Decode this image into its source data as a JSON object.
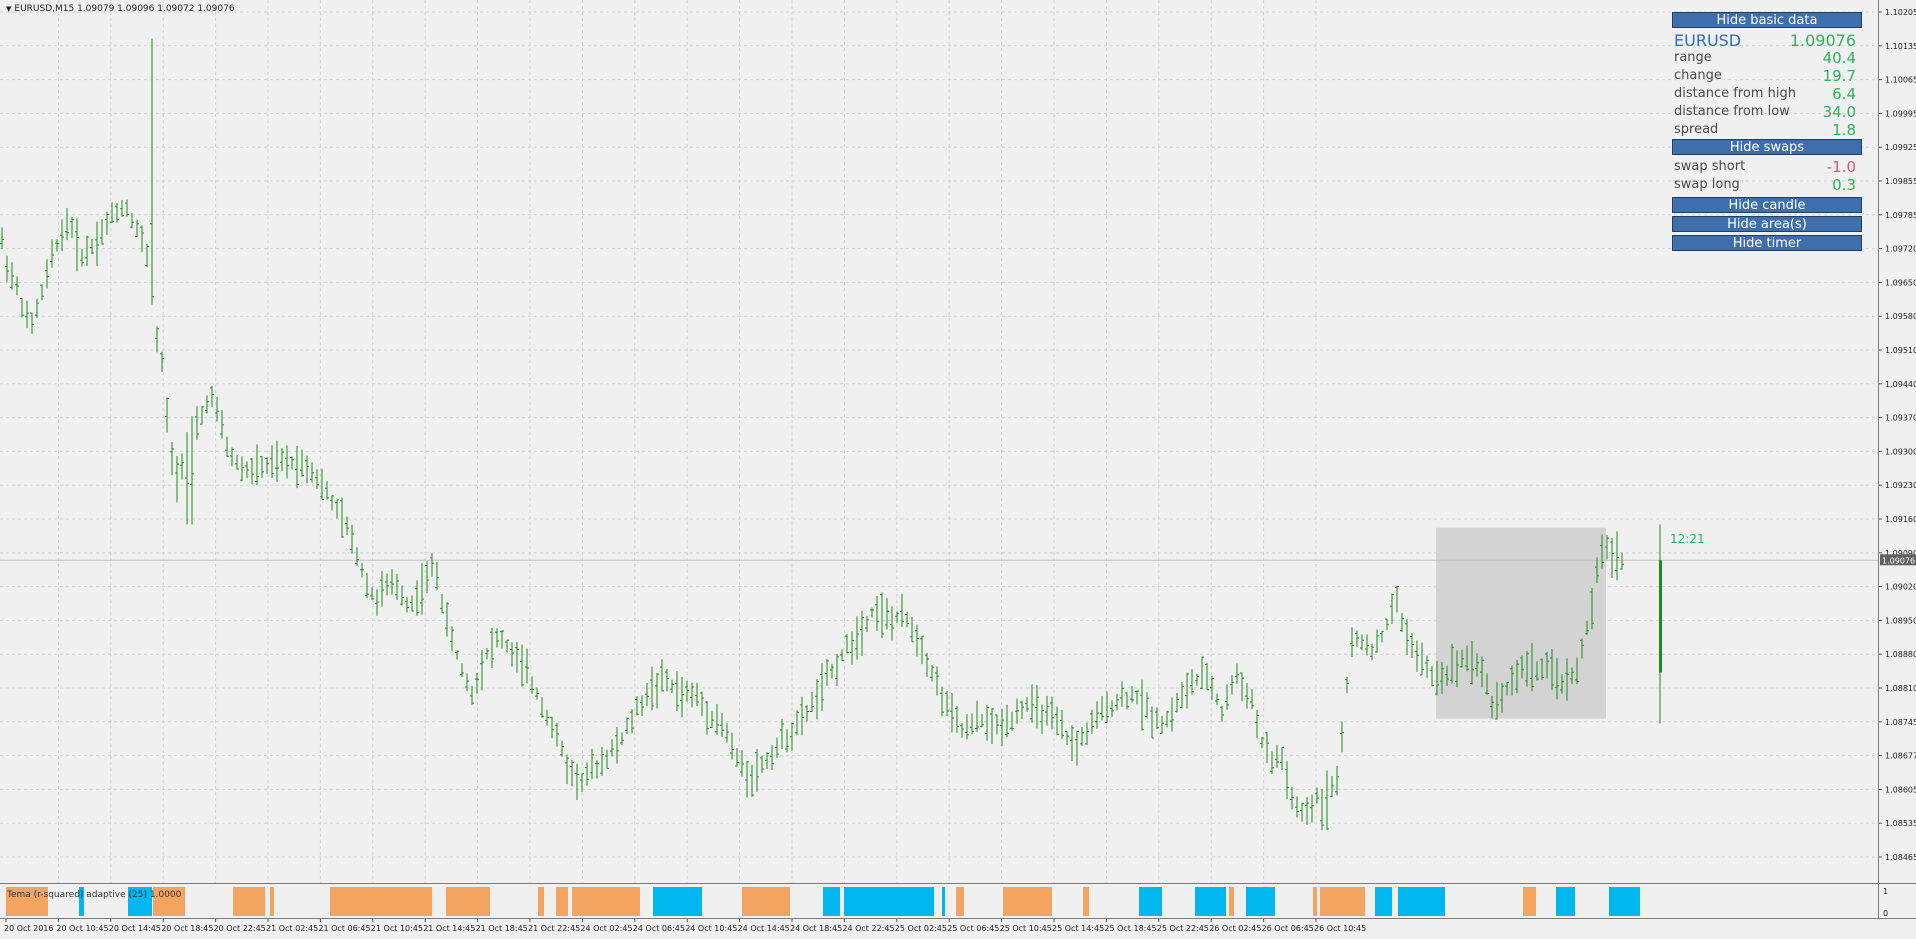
{
  "chart": {
    "header": "EURUSD,M15  1.09079 1.09096 1.09072 1.09076",
    "current_price_label": "1.09076",
    "timer": "12:21",
    "price_scale_labels": [
      "1.10205",
      "1.10135",
      "1.10065",
      "1.09995",
      "1.09925",
      "1.09855",
      "1.09785",
      "1.09720",
      "1.09650",
      "1.09580",
      "1.09510",
      "1.09440",
      "1.09370",
      "1.09300",
      "1.09230",
      "1.09160",
      "1.09090",
      "1.09020",
      "1.08950",
      "1.08880",
      "1.08810",
      "1.08745",
      "1.08677",
      "1.08605",
      "1.08535",
      "1.08465"
    ],
    "time_axis_labels": [
      "20 Oct 2016",
      "20 Oct 10:45",
      "20 Oct 14:45",
      "20 Oct 18:45",
      "20 Oct 22:45",
      "21 Oct 02:45",
      "21 Oct 06:45",
      "21 Oct 10:45",
      "21 Oct 14:45",
      "21 Oct 18:45",
      "21 Oct 22:45",
      "24 Oct 02:45",
      "24 Oct 06:45",
      "24 Oct 10:45",
      "24 Oct 14:45",
      "24 Oct 18:45",
      "24 Oct 22:45",
      "25 Oct 02:45",
      "25 Oct 06:45",
      "25 Oct 10:45",
      "25 Oct 14:45",
      "25 Oct 18:45",
      "25 Oct 22:45",
      "26 Oct 02:45",
      "26 Oct 06:45",
      "26 Oct 10:45"
    ],
    "indicator_label": "Tema (r-squared) adaptive (25) 1.0000",
    "indicator_scale_labels": [
      "1",
      "0"
    ],
    "colors": {
      "bars": "#1f8a1f",
      "up_state": "#f2a460",
      "down_state": "#00b7f0",
      "area_box": "#d3d3d3",
      "grid": "#d0d0d0",
      "price_line": "#c0c0c0",
      "timer": "#2fb35c"
    }
  },
  "panel": {
    "hide_basic_data": "Hide basic data",
    "symbol": "EURUSD",
    "price": "1.09076",
    "stats": [
      {
        "label": "range",
        "value": "40.4"
      },
      {
        "label": "change",
        "value": "19.7"
      },
      {
        "label": "distance from high",
        "value": "6.4"
      },
      {
        "label": "distance from low",
        "value": "34.0"
      },
      {
        "label": "spread",
        "value": "1.8"
      }
    ],
    "hide_swaps": "Hide swaps",
    "swaps": [
      {
        "label": "swap short",
        "value": "-1.0"
      },
      {
        "label": "swap long",
        "value": "0.3"
      }
    ],
    "hide_candle": "Hide candle",
    "hide_areas": "Hide area(s)",
    "hide_timer": "Hide timer"
  }
}
